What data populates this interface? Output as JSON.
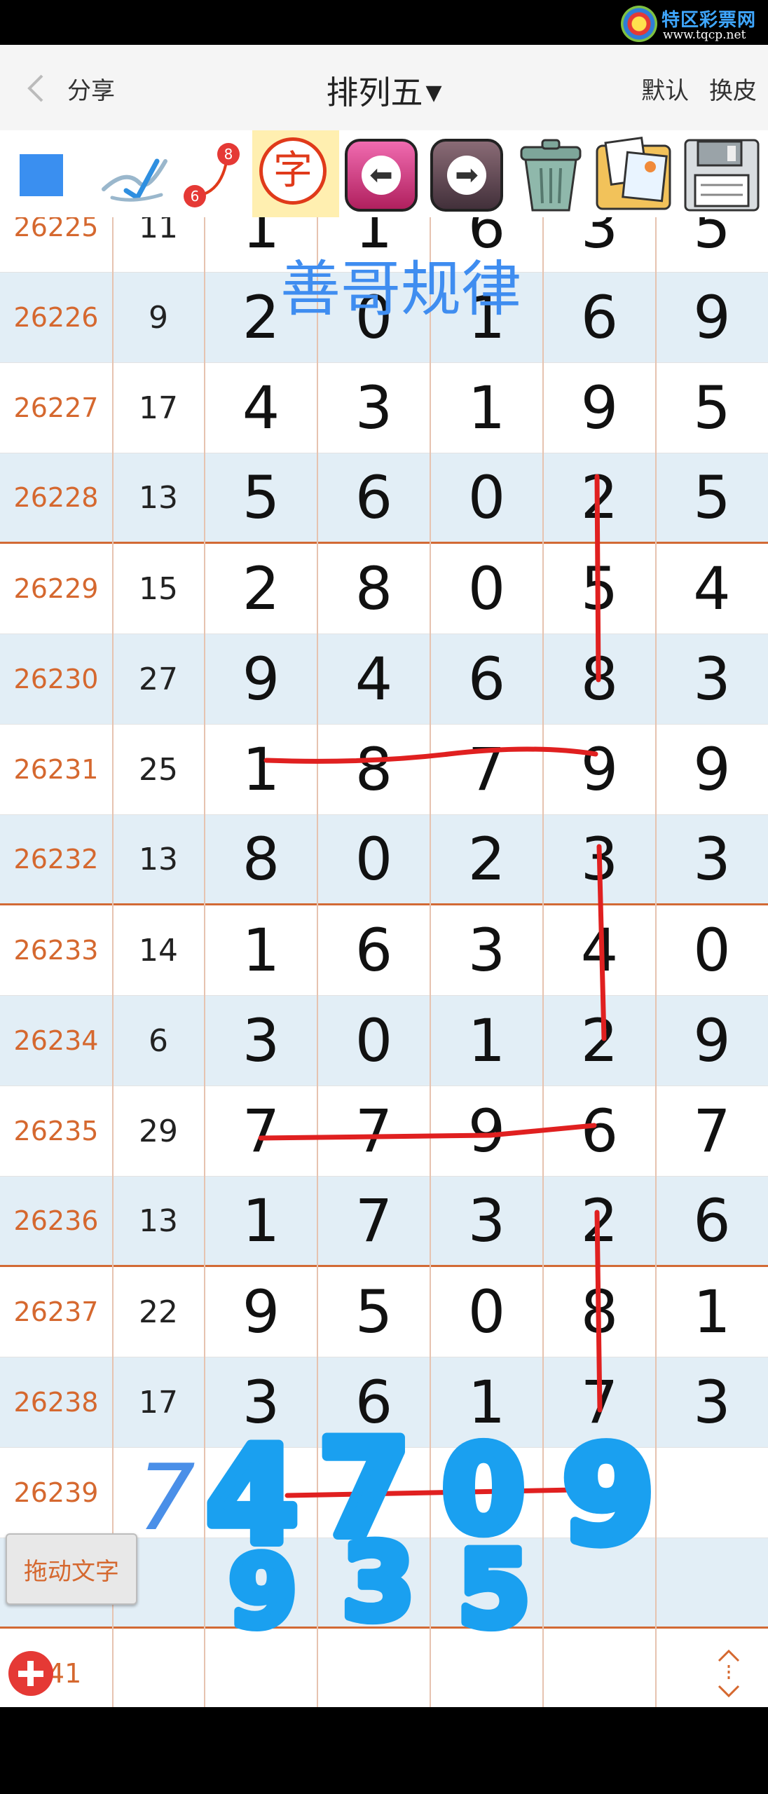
{
  "watermark": {
    "title": "特区彩票网",
    "url": "www.tqcp.net"
  },
  "header": {
    "share_label": "分享",
    "title": "排列五",
    "default_label": "默认",
    "skin_label": "换皮"
  },
  "toolbar": {
    "char_tool_label": "字",
    "badge_top": "8",
    "badge_bottom": "6",
    "icons": [
      "color-square",
      "pen-tool",
      "connect-dots",
      "text-tool",
      "undo",
      "redo",
      "trash",
      "gallery",
      "save"
    ]
  },
  "overlay_text": "善哥规律",
  "rows": [
    {
      "issue": "26225",
      "sum": "11",
      "digits": [
        "1",
        "1",
        "6",
        "3",
        "5"
      ]
    },
    {
      "issue": "26226",
      "sum": "9",
      "digits": [
        "2",
        "0",
        "1",
        "6",
        "9"
      ]
    },
    {
      "issue": "26227",
      "sum": "17",
      "digits": [
        "4",
        "3",
        "1",
        "9",
        "5"
      ]
    },
    {
      "issue": "26228",
      "sum": "13",
      "digits": [
        "5",
        "6",
        "0",
        "2",
        "5"
      ]
    },
    {
      "issue": "26229",
      "sum": "15",
      "digits": [
        "2",
        "8",
        "0",
        "5",
        "4"
      ]
    },
    {
      "issue": "26230",
      "sum": "27",
      "digits": [
        "9",
        "4",
        "6",
        "8",
        "3"
      ]
    },
    {
      "issue": "26231",
      "sum": "25",
      "digits": [
        "1",
        "8",
        "7",
        "9",
        "9"
      ]
    },
    {
      "issue": "26232",
      "sum": "13",
      "digits": [
        "8",
        "0",
        "2",
        "3",
        "3"
      ]
    },
    {
      "issue": "26233",
      "sum": "14",
      "digits": [
        "1",
        "6",
        "3",
        "4",
        "0"
      ]
    },
    {
      "issue": "26234",
      "sum": "6",
      "digits": [
        "3",
        "0",
        "1",
        "2",
        "9"
      ]
    },
    {
      "issue": "26235",
      "sum": "29",
      "digits": [
        "7",
        "7",
        "9",
        "6",
        "7"
      ]
    },
    {
      "issue": "26236",
      "sum": "13",
      "digits": [
        "1",
        "7",
        "3",
        "2",
        "6"
      ]
    },
    {
      "issue": "26237",
      "sum": "22",
      "digits": [
        "9",
        "5",
        "0",
        "8",
        "1"
      ]
    },
    {
      "issue": "26238",
      "sum": "17",
      "digits": [
        "3",
        "6",
        "1",
        "7",
        "3"
      ]
    },
    {
      "issue": "26239",
      "sum": "",
      "digits": [
        "",
        "",
        "",
        "",
        ""
      ]
    },
    {
      "issue": "",
      "sum": "",
      "digits": [
        "",
        "",
        "",
        "",
        ""
      ]
    },
    {
      "issue": "241",
      "sum": "",
      "digits": [
        "",
        "",
        "",
        "",
        ""
      ]
    }
  ],
  "handwriting": {
    "sum_guess": "7",
    "top_digits": [
      "4",
      "7",
      "0",
      "9"
    ],
    "bottom_digits": [
      "9",
      "3",
      "5"
    ]
  },
  "drag_text_button": "拖动文字",
  "colors": {
    "issue_text": "#d5682f",
    "row_alt": "#e2eef6",
    "group_separator": "#d26a35",
    "annotation_line": "#e02020",
    "handwriting": "#1aa0f0",
    "overlay_text": "#3f8df0"
  }
}
